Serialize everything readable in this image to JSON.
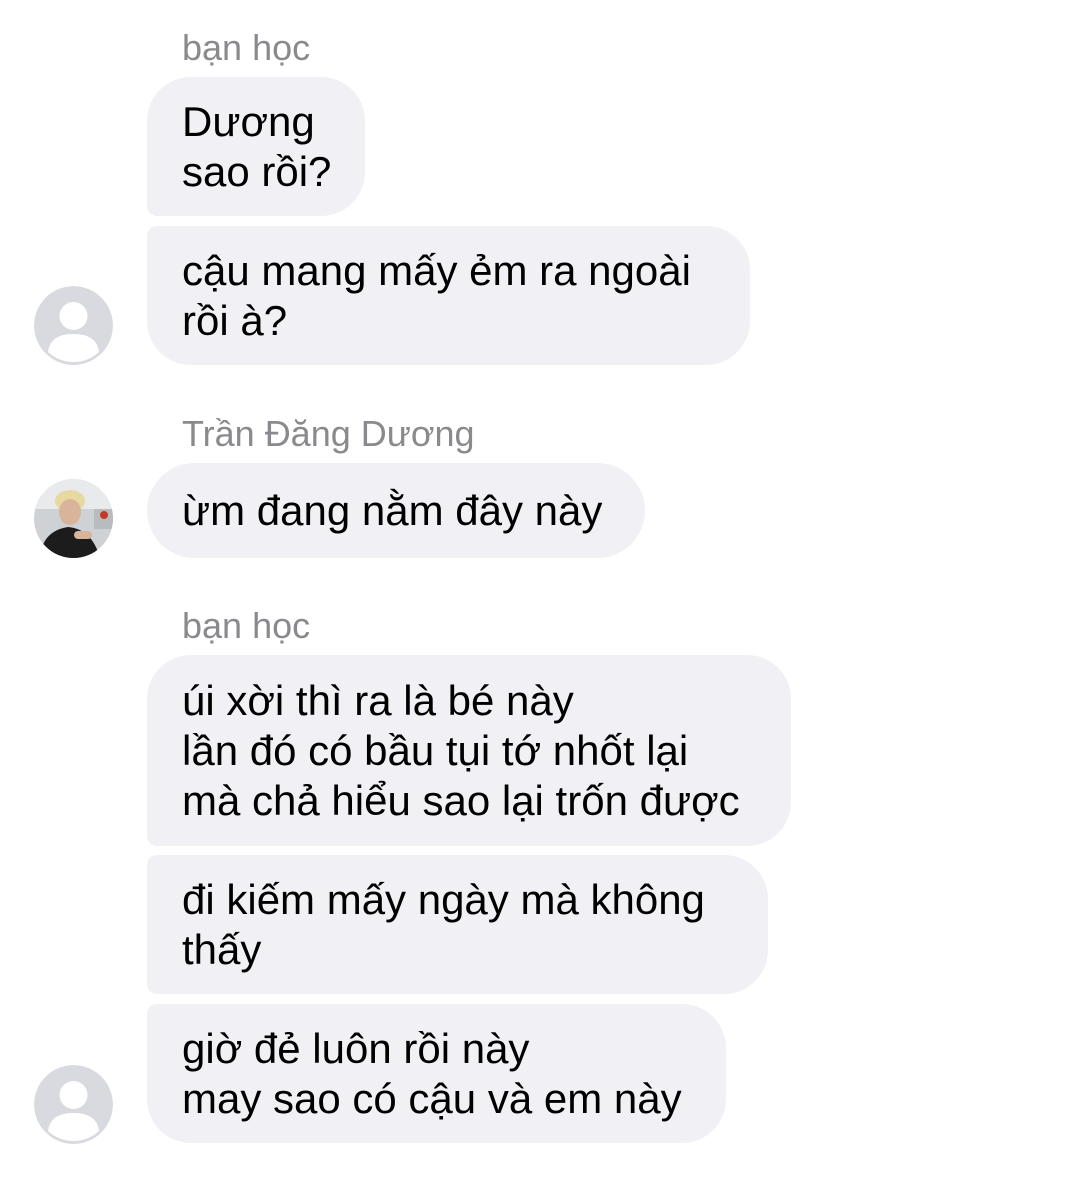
{
  "colors": {
    "bubble_bg": "#f0f0f5",
    "sender_text": "#8a8a8e",
    "message_text": "#000000",
    "avatar_placeholder": "#d9dadf"
  },
  "groups": [
    {
      "sender": "bạn học",
      "avatar": "default-avatar-icon",
      "messages": [
        "Dương\nsao rồi?",
        "cậu mang mấy ẻm ra ngoài\nrồi à?"
      ]
    },
    {
      "sender": "Trần Đăng Dương",
      "avatar": "profile-photo",
      "messages": [
        "ừm đang nằm đây này"
      ]
    },
    {
      "sender": "bạn học",
      "avatar": "default-avatar-icon",
      "messages": [
        "úi xời thì ra là bé này\nlần đó có bầu tụi tớ nhốt lại\nmà chả hiểu sao lại trốn được",
        "đi kiếm mấy ngày mà không\nthấy",
        "giờ đẻ luôn rồi này\nmay sao có cậu và em này"
      ]
    }
  ]
}
